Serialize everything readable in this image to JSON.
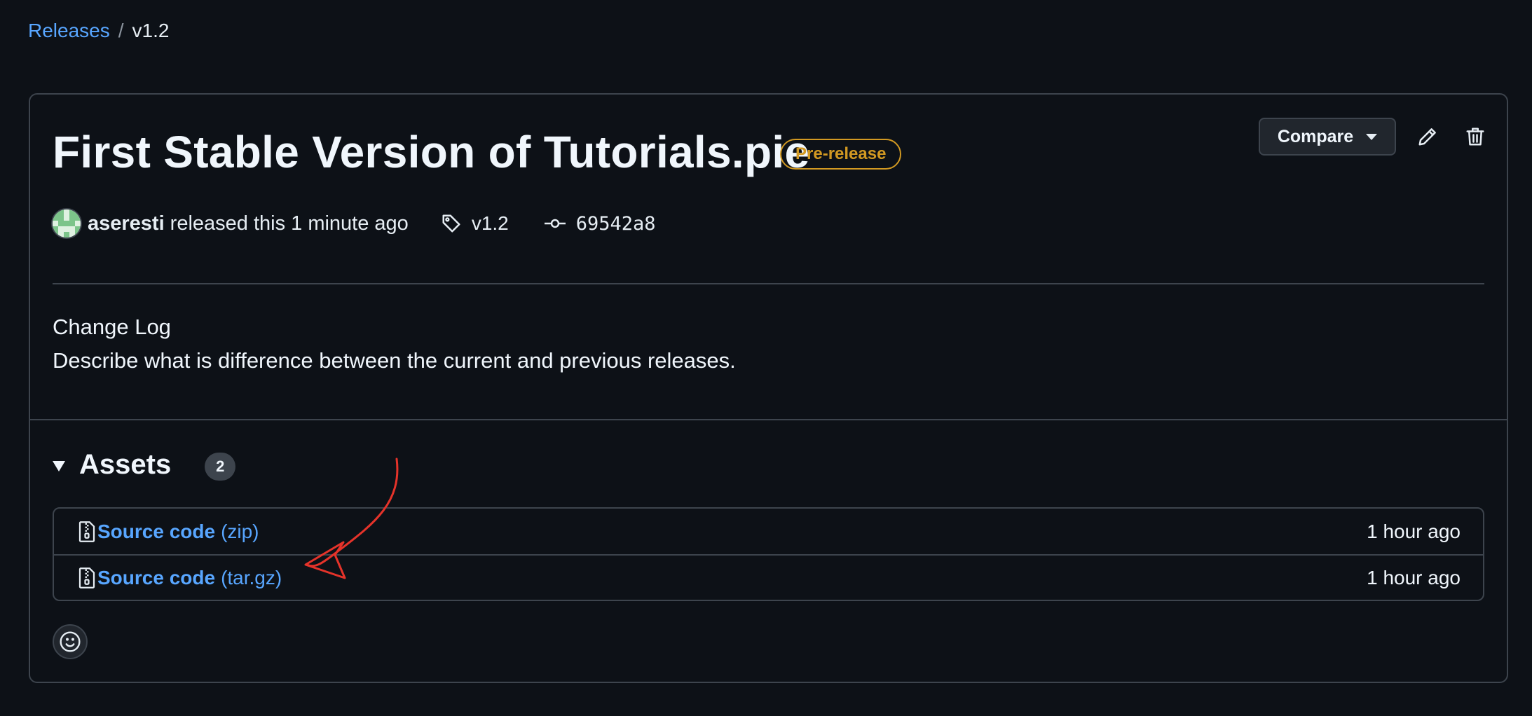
{
  "breadcrumb": {
    "releases": "Releases",
    "separator": "/",
    "current": "v1.2"
  },
  "release": {
    "title": "First Stable Version of Tutorials.pie",
    "badge": "Pre-release",
    "author": "aseresti",
    "released_text": "released this 1 minute ago",
    "tag": "v1.2",
    "commit": "69542a8",
    "body_heading": "Change Log",
    "body_text": "Describe what is difference between the current and previous releases."
  },
  "actions": {
    "compare_label": "Compare"
  },
  "assets": {
    "title": "Assets",
    "count": "2",
    "items": [
      {
        "name": "Source code",
        "ext": "(zip)",
        "time": "1 hour ago"
      },
      {
        "name": "Source code",
        "ext": "(tar.gz)",
        "time": "1 hour ago"
      }
    ]
  },
  "colors": {
    "background": "#0d1117",
    "link": "#58a6ff",
    "prerelease": "#d29922",
    "border": "#3d444d",
    "annotation_arrow": "#e5332a"
  },
  "icons": [
    "tag-icon",
    "commit-icon",
    "pencil-icon",
    "trash-icon",
    "file-zip-icon",
    "smiley-icon",
    "triangle-down-icon"
  ]
}
